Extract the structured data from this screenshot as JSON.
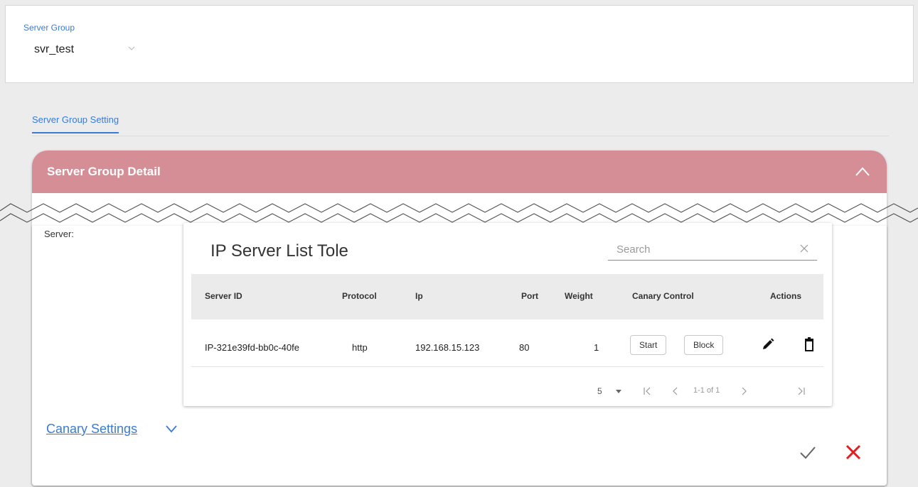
{
  "server_group": {
    "label": "Server Group",
    "selected": "svr_test"
  },
  "tabs": [
    {
      "label": "Server Group Setting",
      "active": true
    }
  ],
  "detail": {
    "title": "Server Group Detail",
    "server_label": "Server:"
  },
  "server_list": {
    "title": "IP Server List Tole",
    "search_placeholder": "Search",
    "columns": [
      "Server ID",
      "Protocol",
      "Ip",
      "Port",
      "Weight",
      "Canary Control",
      "Actions"
    ],
    "rows": [
      {
        "server_id": "IP-321e39fd-bb0c-40fe",
        "protocol": "http",
        "ip": "192.168.15.123",
        "port": "80",
        "weight": "1",
        "start_label": "Start",
        "block_label": "Block"
      }
    ],
    "pagination": {
      "page_size": "5",
      "range": "1-1 of 1"
    }
  },
  "canary": {
    "link_label": "Canary Settings"
  },
  "colors": {
    "accent": "#3a7bd5",
    "header": "#d58e95",
    "cancel": "#e02020"
  },
  "icons": [
    "chevron-down-icon",
    "chevron-up-icon",
    "close-icon",
    "pencil-icon",
    "trash-icon",
    "first-page-icon",
    "prev-page-icon",
    "next-page-icon",
    "last-page-icon",
    "check-icon",
    "cancel-icon"
  ]
}
